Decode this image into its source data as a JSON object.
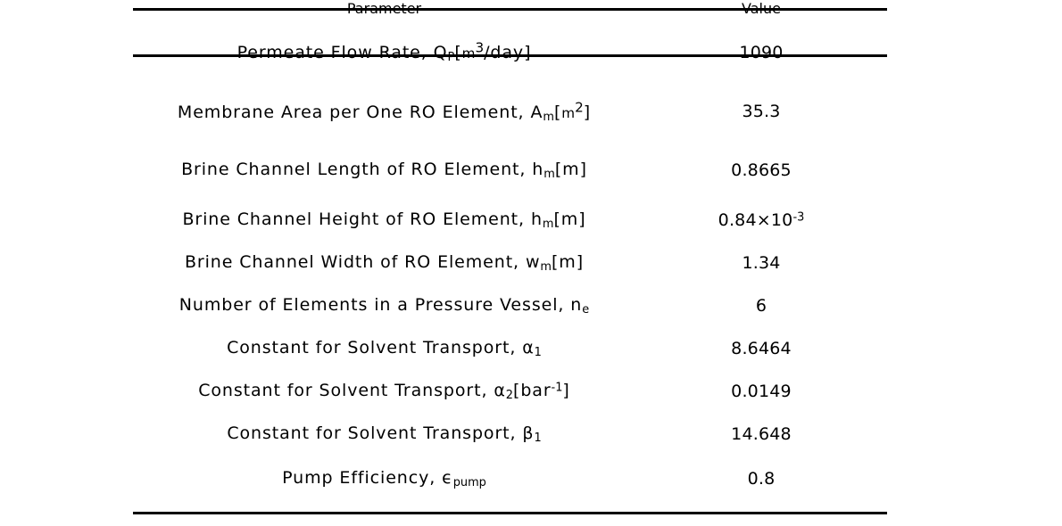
{
  "table": {
    "headers": {
      "parameter": "Parameter",
      "value": "Value"
    },
    "rows": [
      {
        "parameter_plain": "Permeate Flow Rate, QP[m³/day]",
        "label": "Permeate Flow Rate,",
        "symbol": "Q",
        "symbol_sub": "P",
        "unit_open": "[",
        "unit": "m",
        "unit_exp": "3",
        "unit_rest": "/day",
        "unit_close": "]",
        "value": "1090"
      },
      {
        "parameter_plain": "Membrane Area per One RO Element, Am[m²]",
        "label": "Membrane Area per One RO Element,",
        "symbol": "A",
        "symbol_sub": "m",
        "unit_open": "[",
        "unit": "m",
        "unit_exp": "2",
        "unit_rest": "",
        "unit_close": "]",
        "value": "35.3"
      },
      {
        "parameter_plain": "Brine Channel Length of RO Element, hm[m]",
        "label": "Brine Channel Length of RO Element,",
        "symbol": "h",
        "symbol_sub": "m",
        "unit_open": "[",
        "unit": "m",
        "unit_exp": "",
        "unit_rest": "",
        "unit_close": "]",
        "value": "0.8665"
      },
      {
        "parameter_plain": "Brine Channel Height of RO Element, hm[m]",
        "label": "Brine Channel Height of RO Element,",
        "symbol": "h",
        "symbol_sub": "m",
        "unit_open": "[",
        "unit": "m",
        "unit_exp": "",
        "unit_rest": "",
        "unit_close": "]",
        "value_mantissa": "0.84×10",
        "value_exp": "-3",
        "value": "0.84×10⁻³"
      },
      {
        "parameter_plain": "Brine Channel Width of RO Element, wm[m]",
        "label": "Brine Channel Width of RO Element,",
        "symbol": "w",
        "symbol_sub": "m",
        "unit_open": "[",
        "unit": "m",
        "unit_exp": "",
        "unit_rest": "",
        "unit_close": "]",
        "value": "1.34"
      },
      {
        "parameter_plain": "Number of Elements in a Pressure Vessel, ne",
        "label": "Number of Elements in a Pressure Vessel,",
        "symbol": "n",
        "symbol_sub": "e",
        "unit_open": "",
        "unit": "",
        "unit_exp": "",
        "unit_rest": "",
        "unit_close": "",
        "value": "6"
      },
      {
        "parameter_plain": "Constant for Solvent Transport, α1",
        "label": "Constant for Solvent Transport,",
        "symbol": "α",
        "symbol_sub": "1",
        "unit_open": "",
        "unit": "",
        "unit_exp": "",
        "unit_rest": "",
        "unit_close": "",
        "value": "8.6464"
      },
      {
        "parameter_plain": "Constant for Solvent Transport, α2[bar⁻¹]",
        "label": "Constant for Solvent Transport,",
        "symbol": "α",
        "symbol_sub": "2",
        "unit_open": "[",
        "unit": "bar",
        "unit_exp": "-1",
        "unit_rest": "",
        "unit_close": "]",
        "value": "0.0149"
      },
      {
        "parameter_plain": "Constant for Solvent Transport, β1",
        "label": "Constant for Solvent Transport,",
        "symbol": "β",
        "symbol_sub": "1",
        "unit_open": "",
        "unit": "",
        "unit_exp": "",
        "unit_rest": "",
        "unit_close": "",
        "value": "14.648"
      },
      {
        "parameter_plain": "Pump Efficiency, ϵpump",
        "label": "Pump Efficiency,",
        "symbol": "ϵ",
        "symbol_sub": "pump",
        "unit_open": "",
        "unit": "",
        "unit_exp": "",
        "unit_rest": "",
        "unit_close": "",
        "value": "0.8"
      }
    ]
  },
  "colors": {
    "text": "#000000",
    "rule": "#000000",
    "background": "#ffffff"
  }
}
